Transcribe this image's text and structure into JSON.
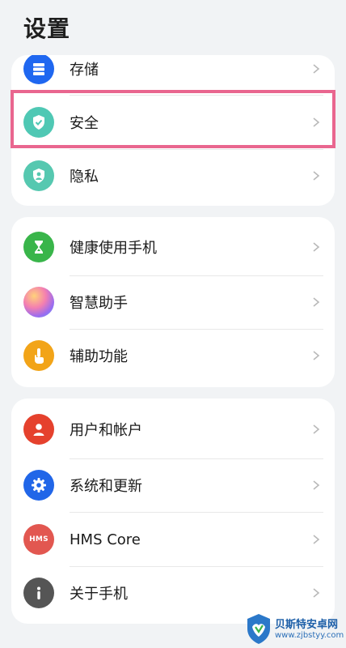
{
  "header": {
    "title": "设置"
  },
  "groups": [
    {
      "items": [
        {
          "label": "存储",
          "icon": "storage-icon",
          "color": "#1f67f0"
        },
        {
          "label": "安全",
          "icon": "shield-check-icon",
          "color": "#4fc8b4"
        },
        {
          "label": "隐私",
          "icon": "privacy-shield-icon",
          "color": "#56c8b0"
        }
      ]
    },
    {
      "items": [
        {
          "label": "健康使用手机",
          "icon": "hourglass-icon",
          "color": "#39b54a"
        },
        {
          "label": "智慧助手",
          "icon": "assistant-orb-icon",
          "color": "#e974b9"
        },
        {
          "label": "辅助功能",
          "icon": "hand-pointer-icon",
          "color": "#f2a418"
        }
      ]
    },
    {
      "items": [
        {
          "label": "用户和帐户",
          "icon": "user-icon",
          "color": "#e5412d"
        },
        {
          "label": "系统和更新",
          "icon": "gear-icon",
          "color": "#2166e8"
        },
        {
          "label": "HMS Core",
          "icon": "hms-logo-icon",
          "color": "#e25750"
        },
        {
          "label": "关于手机",
          "icon": "info-icon",
          "color": "#555555"
        }
      ]
    }
  ],
  "hms_icon_text": "HMS",
  "watermark": {
    "line1": "贝斯特安卓网",
    "line2": "www.zjbstyy.com"
  }
}
